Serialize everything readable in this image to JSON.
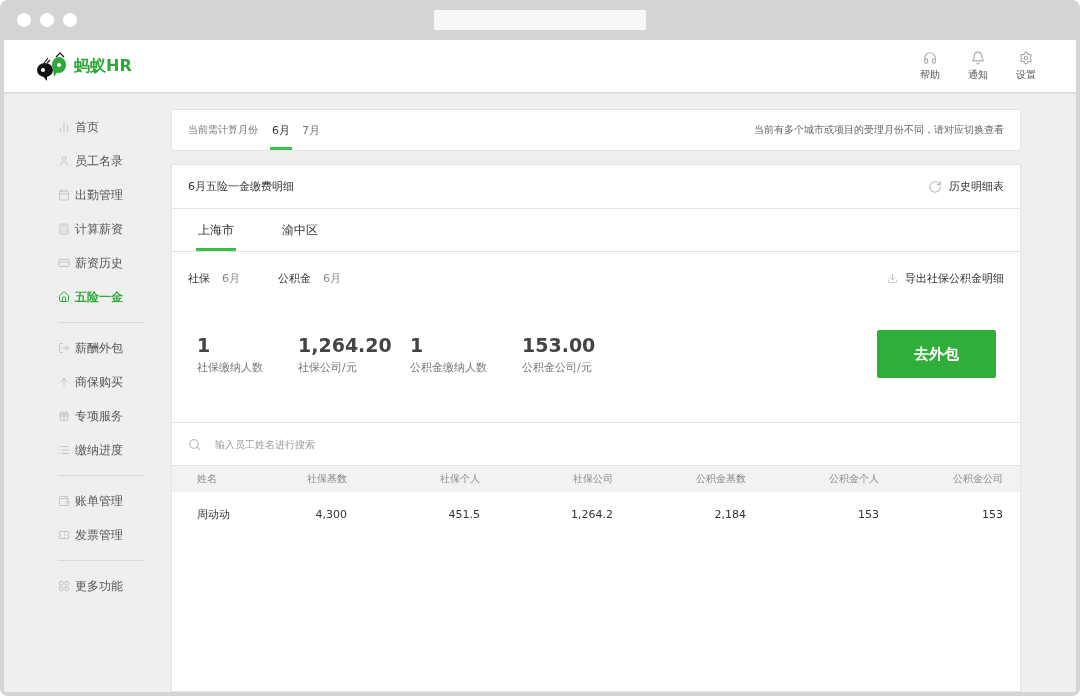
{
  "header": {
    "logo_text": "蚂蚁HR",
    "actions": [
      {
        "kind": "help",
        "label": "帮助"
      },
      {
        "kind": "bell",
        "label": "通知"
      },
      {
        "kind": "gear",
        "label": "设置"
      }
    ]
  },
  "sidebar": {
    "groups": [
      [
        {
          "kind": "chart",
          "label": "首页",
          "selected": false
        },
        {
          "kind": "user",
          "label": "员工名录",
          "selected": false
        },
        {
          "kind": "calendar",
          "label": "出勤管理",
          "selected": false
        },
        {
          "kind": "calc",
          "label": "计算薪资",
          "selected": false
        },
        {
          "kind": "card",
          "label": "薪资历史",
          "selected": false
        },
        {
          "kind": "house",
          "label": "五险一金",
          "selected": true
        }
      ],
      [
        {
          "kind": "exit",
          "label": "薪酬外包",
          "selected": false
        },
        {
          "kind": "up",
          "label": "商保购买",
          "selected": false
        },
        {
          "kind": "gift",
          "label": "专项服务",
          "selected": false
        },
        {
          "kind": "list",
          "label": "缴纳进度",
          "selected": false
        }
      ],
      [
        {
          "kind": "wallet",
          "label": "账单管理",
          "selected": false
        },
        {
          "kind": "ticket",
          "label": "发票管理",
          "selected": false
        }
      ],
      [
        {
          "kind": "grid",
          "label": "更多功能",
          "selected": false
        }
      ]
    ]
  },
  "month_bar": {
    "label": "当前需计算月份",
    "months": [
      {
        "label": "6月",
        "selected": true
      },
      {
        "label": "7月",
        "selected": false
      }
    ],
    "notice": "当前有多个城市或项目的受理月份不同，请对应切换查看"
  },
  "detail": {
    "title": "6月五险一金缴费明细",
    "history_link": "历史明细表",
    "city_tabs": [
      {
        "label": "上海市",
        "selected": true
      },
      {
        "label": "渝中区",
        "selected": false
      }
    ],
    "periods": [
      {
        "label": "社保",
        "value": "6月"
      },
      {
        "label": "公积金",
        "value": "6月"
      }
    ],
    "export_link": "导出社保公积金明细",
    "stats": [
      {
        "value": "1",
        "label": "社保缴纳人数"
      },
      {
        "value": "1,264.20",
        "label": "社保公司/元"
      },
      {
        "value": "1",
        "label": "公积金缴纳人数"
      },
      {
        "value": "153.00",
        "label": "公积金公司/元"
      }
    ],
    "outsource_button": "去外包",
    "search": {
      "placeholder": "输入员工姓名进行搜索"
    },
    "table": {
      "columns": [
        "姓名",
        "社保基数",
        "社保个人",
        "社保公司",
        "公积金基数",
        "公积金个人",
        "公积金公司"
      ],
      "rows": [
        [
          "周动动",
          "4,300",
          "451.5",
          "1,264.2",
          "2,184",
          "153",
          "153"
        ]
      ]
    }
  }
}
